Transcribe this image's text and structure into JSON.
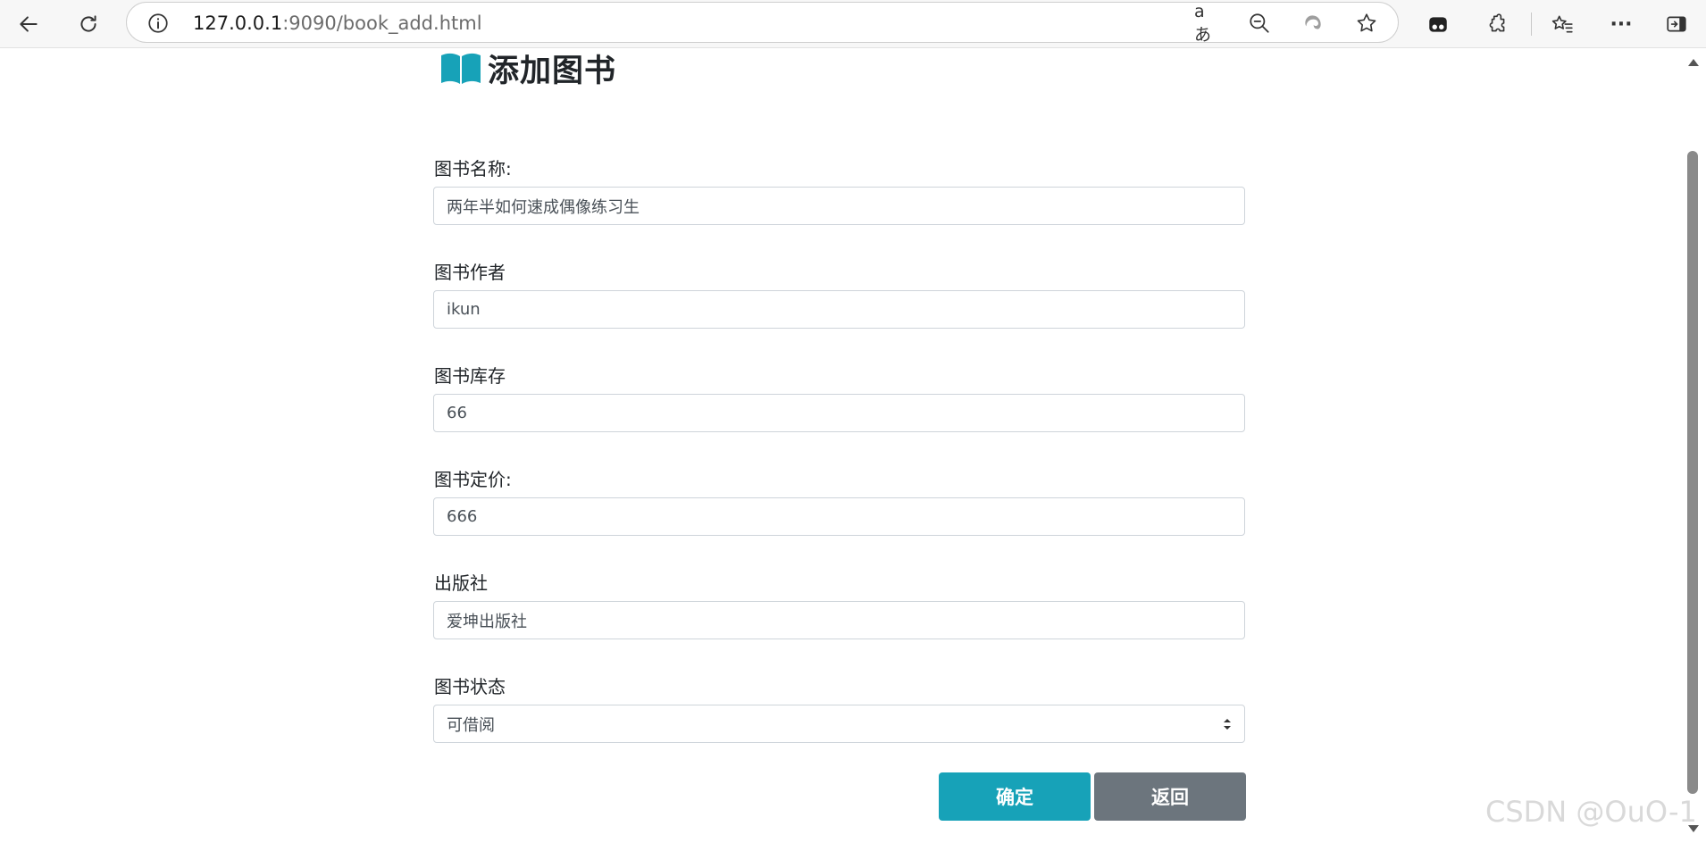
{
  "browser": {
    "url_host": "127.0.0.1",
    "url_rest": ":9090/book_add.html",
    "icons": {
      "back": "back-arrow-icon",
      "reload": "reload-icon",
      "info": "info-icon",
      "translate": "translate-icon",
      "zoom": "zoom-out-icon",
      "edge": "edge-icon",
      "favorite": "star-icon",
      "profile": "profile-icon",
      "extensions": "puzzle-icon",
      "favorites": "favorites-icon",
      "more": "more-icon",
      "sidebar": "sidebar-icon"
    },
    "translate_text": "aあ",
    "more_text": "···"
  },
  "page": {
    "title": "添加图书",
    "title_icon": "book-icon",
    "fields": [
      {
        "label": "图书名称:",
        "value": "两年半如何速成偶像练习生"
      },
      {
        "label": "图书作者",
        "value": "ikun"
      },
      {
        "label": "图书库存",
        "value": "66"
      },
      {
        "label": "图书定价:",
        "value": "666"
      },
      {
        "label": "出版社",
        "value": "爱坤出版社"
      },
      {
        "label": "图书状态",
        "value": "可借阅",
        "type": "select"
      }
    ],
    "buttons": {
      "confirm": "确定",
      "back": "返回"
    }
  },
  "watermark": "CSDN @OuO-1",
  "colors": {
    "accent": "#17a2b8",
    "secondary": "#6c757d"
  }
}
